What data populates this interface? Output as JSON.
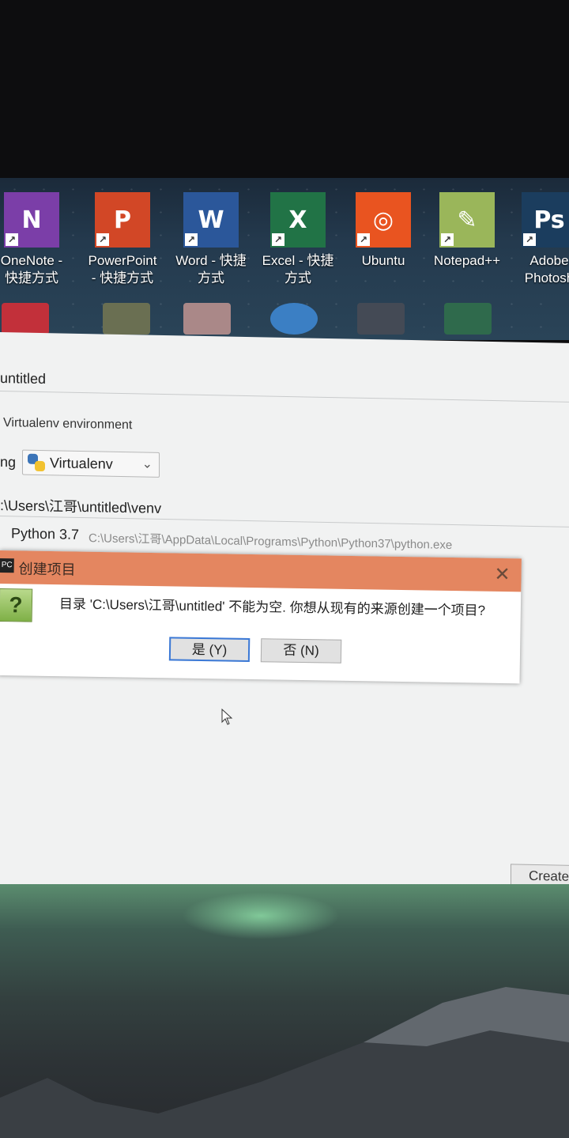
{
  "desktop": {
    "icons": [
      {
        "label": "OneNote -\n快捷方式",
        "glyph": "N",
        "color": "#7b3ea8"
      },
      {
        "label": "PowerPoint\n- 快捷方式",
        "glyph": "P",
        "color": "#d24726"
      },
      {
        "label": "Word - 快捷\n方式",
        "glyph": "W",
        "color": "#2b579a"
      },
      {
        "label": "Excel - 快捷\n方式",
        "glyph": "X",
        "color": "#217346"
      },
      {
        "label": "Ubuntu",
        "glyph": "◎",
        "color": "#e95420"
      },
      {
        "label": "Notepad++",
        "glyph": "✎",
        "color": "#9ab65a"
      },
      {
        "label": "Adobe\nPhotosh",
        "glyph": "Ps",
        "color": "#1b3d5e"
      }
    ]
  },
  "ide": {
    "location_value": "untitled",
    "env_section_label": "Virtualenv environment",
    "using_label": "ng",
    "env_select_value": "Virtualenv",
    "location_path": ":\\Users\\江哥\\untitled\\venv",
    "interpreter_name": "Python 3.7",
    "interpreter_path": "C:\\Users\\江哥\\AppData\\Local\\Programs\\Python\\Python37\\python.exe",
    "create_button": "Create"
  },
  "dialog": {
    "title": "创建项目",
    "app_icon_text": "PC",
    "question_glyph": "?",
    "message": "目录 'C:\\Users\\江哥\\untitled' 不能为空. 你想从现有的来源创建一个项目?",
    "yes_label": "是 (Y)",
    "no_label": "否 (N)",
    "close_glyph": "✕"
  },
  "colors": {
    "dialog_title_bar": "#e48660",
    "yes_focus_border": "#3a78d6"
  }
}
